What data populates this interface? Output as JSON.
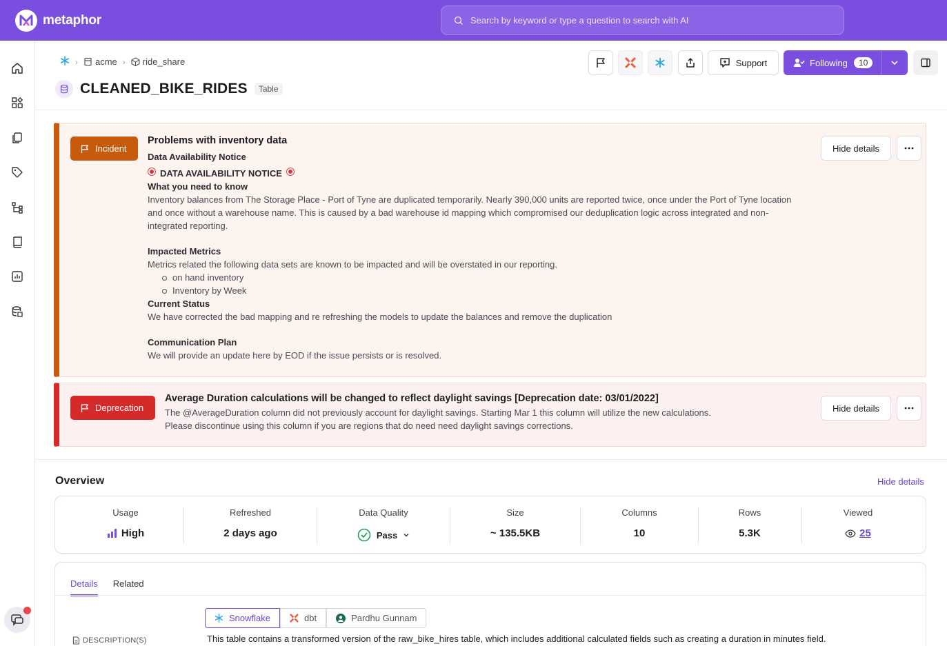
{
  "app": {
    "name": "metaphor"
  },
  "search": {
    "placeholder": "Search by keyword or type a question to search with AI"
  },
  "breadcrumb": [
    {
      "label": "acme"
    },
    {
      "label": "ride_share"
    }
  ],
  "asset": {
    "title": "CLEANED_BIKE_RIDES",
    "type": "Table"
  },
  "header_actions": {
    "support_label": "Support",
    "following_label": "Following",
    "following_count": "10"
  },
  "incident": {
    "badge": "Incident",
    "title": "Problems with inventory data",
    "subtitle": "Data Availability Notice",
    "notice": "DATA AVAILABILITY NOTICE",
    "h_know": "What you need to know",
    "p_know": "Inventory balances from The Storage Place - Port of Tyne are duplicated temporarily. Nearly 390,000 units are reported twice, once under the Port of Tyne location and once without a warehouse name. This is caused by a bad warehouse id mapping which compromised our deduplication logic across integrated and non-integrated reporting.",
    "h_metrics": "Impacted Metrics",
    "p_metrics": "Metrics related the following data sets are known to be impacted and will be overstated in our reporting.",
    "bullets": [
      "on hand inventory",
      "Inventory by Week"
    ],
    "h_status": "Current Status",
    "p_status": "We have corrected the bad mapping and re refreshing the models to update the balances and remove the duplication",
    "h_comm": "Communication Plan",
    "p_comm": "We will provide an update here by EOD if the issue persists or is resolved.",
    "hide_label": "Hide details"
  },
  "deprecation": {
    "badge": "Deprecation",
    "title": "Average Duration calculations will be changed to reflect daylight savings [Deprecation date: 03/01/2022]",
    "line1": "The @AverageDuration column did not previously account for daylight savings. Starting Mar 1 this column will utilize the new calculations.",
    "line2": "Please discontinue using this column if you are regions that do need need daylight savings corrections.",
    "hide_label": "Hide details"
  },
  "overview": {
    "title": "Overview",
    "hide_label": "Hide details",
    "stats": [
      {
        "label": "Usage",
        "value": "High"
      },
      {
        "label": "Refreshed",
        "value": "2 days ago"
      },
      {
        "label": "Data Quality",
        "value": "Pass"
      },
      {
        "label": "Size",
        "value": "~ 135.5KB"
      },
      {
        "label": "Columns",
        "value": "10"
      },
      {
        "label": "Rows",
        "value": "5.3K"
      },
      {
        "label": "Viewed",
        "value": "25"
      }
    ]
  },
  "details": {
    "tabs": [
      "Details",
      "Related"
    ],
    "sources": [
      "Snowflake",
      "dbt",
      "Pardhu Gunnam"
    ],
    "description_label": "DESCRIPTION(S)",
    "description_text": "This table contains a transformed version of the raw_bike_hires table, which includes additional calculated fields such as creating a duration in minutes field."
  },
  "colors": {
    "brand": "#7a4fe0",
    "incident": "#c85a0c",
    "deprecation": "#d62929",
    "pass": "#1f9d55"
  },
  "icons": [
    "home-icon",
    "grid-icon",
    "documents-icon",
    "tag-icon",
    "lineage-icon",
    "book-icon",
    "chart-icon",
    "database-icon",
    "chat-icon"
  ]
}
